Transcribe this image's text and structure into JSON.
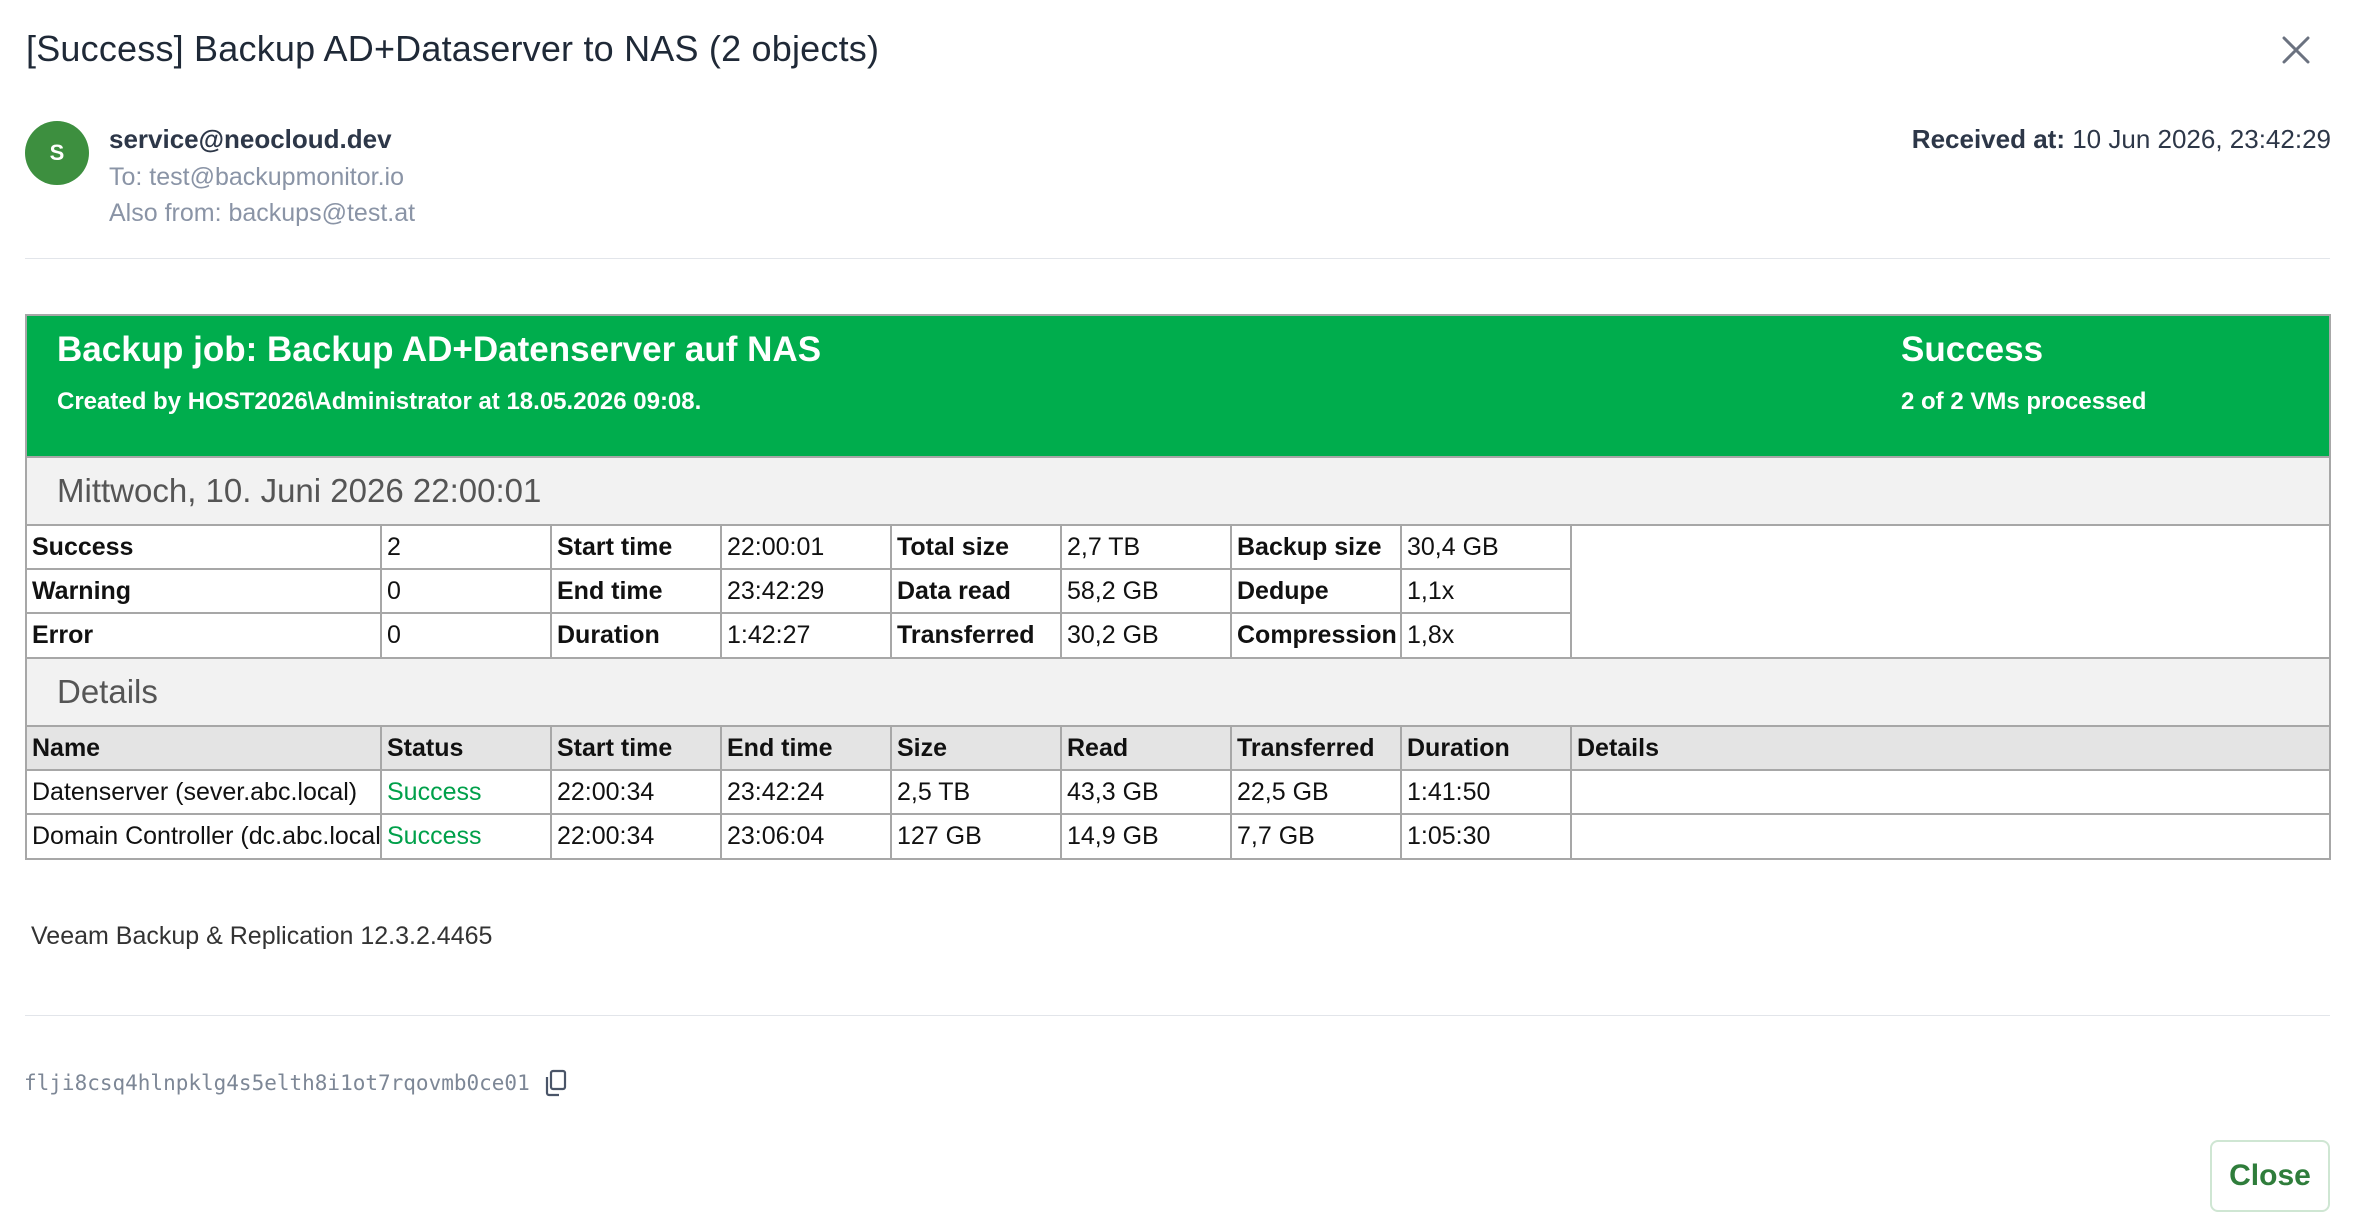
{
  "dialog": {
    "title": "[Success] Backup AD+Dataserver to NAS (2 objects)",
    "close_button_label": "Close"
  },
  "email": {
    "avatar_initial": "S",
    "sender": "service@neocloud.dev",
    "to": "To: test@backupmonitor.io",
    "also_from": "Also from: backups@test.at",
    "received_label": "Received at:",
    "received_value": "10 Jun 2026, 23:42:29"
  },
  "report": {
    "banner": {
      "job_title": "Backup job: Backup AD+Datenserver auf NAS",
      "created": "Created by HOST2026\\Administrator at 18.05.2026 09:08.",
      "status": "Success",
      "processed": "2 of 2 VMs processed",
      "color": "#00ad4d"
    },
    "run_date": "Mittwoch, 10. Juni 2026 22:00:01",
    "summary": [
      [
        "Success",
        "2",
        "Start time",
        "22:00:01",
        "Total size",
        "2,7 TB",
        "Backup size",
        "30,4 GB"
      ],
      [
        "Warning",
        "0",
        "End time",
        "23:42:29",
        "Data read",
        "58,2 GB",
        "Dedupe",
        "1,1x"
      ],
      [
        "Error",
        "0",
        "Duration",
        "1:42:27",
        "Transferred",
        "30,2 GB",
        "Compression",
        "1,8x"
      ]
    ],
    "details_heading": "Details",
    "details_columns": [
      "Name",
      "Status",
      "Start time",
      "End time",
      "Size",
      "Read",
      "Transferred",
      "Duration",
      "Details"
    ],
    "details_rows": [
      [
        "Datenserver (sever.abc.local)",
        "Success",
        "22:00:34",
        "23:42:24",
        "2,5 TB",
        "43,3 GB",
        "22,5 GB",
        "1:41:50",
        ""
      ],
      [
        "Domain Controller (dc.abc.local)",
        "Success",
        "22:00:34",
        "23:06:04",
        "127 GB",
        "14,9 GB",
        "7,7 GB",
        "1:05:30",
        ""
      ]
    ],
    "footer_note": "Veeam Backup & Replication 12.3.2.4465",
    "success_color": "#00a04a"
  },
  "message_id": "flji8csq4hlnpklg4s5elth8i1ot7rqovmb0ce01",
  "icons": {
    "close": "close-icon",
    "copy": "copy-icon"
  }
}
